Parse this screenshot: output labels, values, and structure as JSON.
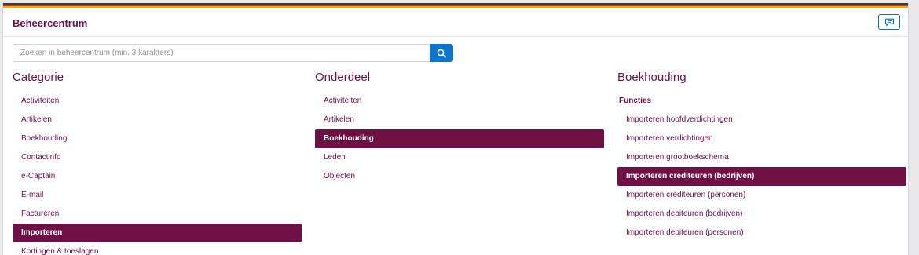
{
  "header": {
    "title": "Beheercentrum",
    "chat_button_icon": "chat-icon"
  },
  "search": {
    "placeholder": "Zoeken in beheercentrum (min. 3 karakters)",
    "value": "",
    "button_icon": "search-icon"
  },
  "categorie": {
    "heading": "Categorie",
    "items": [
      {
        "label": "Activiteiten",
        "active": false
      },
      {
        "label": "Artikelen",
        "active": false
      },
      {
        "label": "Boekhouding",
        "active": false
      },
      {
        "label": "Contactinfo",
        "active": false
      },
      {
        "label": "e-Captain",
        "active": false
      },
      {
        "label": "E-mail",
        "active": false
      },
      {
        "label": "Factureren",
        "active": false
      },
      {
        "label": "Importeren",
        "active": true
      },
      {
        "label": "Kortingen & toeslagen",
        "active": false
      }
    ]
  },
  "onderdeel": {
    "heading": "Onderdeel",
    "items": [
      {
        "label": "Activiteiten",
        "active": false
      },
      {
        "label": "Artikelen",
        "active": false
      },
      {
        "label": "Boekhouding",
        "active": true
      },
      {
        "label": "Leden",
        "active": false
      },
      {
        "label": "Objecten",
        "active": false
      }
    ]
  },
  "boekhouding": {
    "heading": "Boekhouding",
    "section_label": "Functies",
    "items": [
      {
        "label": "Importeren hoofdverdichtingen",
        "active": false
      },
      {
        "label": "Importeren verdichtingen",
        "active": false
      },
      {
        "label": "Importeren grootboekschema",
        "active": false
      },
      {
        "label": "Importeren crediteuren (bedrijven)",
        "active": true
      },
      {
        "label": "Importeren crediteuren (personen)",
        "active": false
      },
      {
        "label": "Importeren debiteuren (bedrijven)",
        "active": false
      },
      {
        "label": "Importeren debiteuren (personen)",
        "active": false
      }
    ]
  },
  "colors": {
    "accent": "#6d1044",
    "primary_button": "#0b74d1"
  }
}
